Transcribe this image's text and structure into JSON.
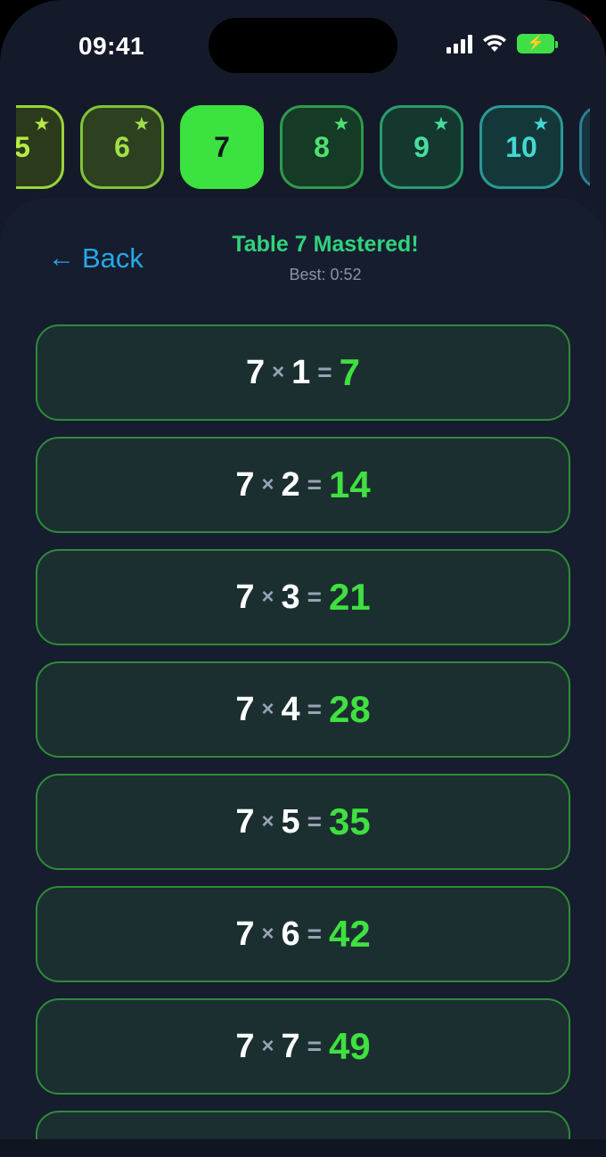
{
  "status_bar": {
    "time": "09:41"
  },
  "selector": {
    "chips": [
      {
        "label": "5",
        "starred": true
      },
      {
        "label": "6",
        "starred": true
      },
      {
        "label": "7",
        "starred": false,
        "selected": true
      },
      {
        "label": "8",
        "starred": true
      },
      {
        "label": "9",
        "starred": true
      },
      {
        "label": "10",
        "starred": true
      }
    ],
    "star_glyph": "★"
  },
  "header": {
    "back_label": "Back",
    "back_arrow": "←",
    "title": "Table 7 Mastered!",
    "subtitle": "Best: 0:52"
  },
  "equations": [
    {
      "a": "7",
      "op": "×",
      "b": "1",
      "eq": "=",
      "result": "7"
    },
    {
      "a": "7",
      "op": "×",
      "b": "2",
      "eq": "=",
      "result": "14"
    },
    {
      "a": "7",
      "op": "×",
      "b": "3",
      "eq": "=",
      "result": "21"
    },
    {
      "a": "7",
      "op": "×",
      "b": "4",
      "eq": "=",
      "result": "28"
    },
    {
      "a": "7",
      "op": "×",
      "b": "5",
      "eq": "=",
      "result": "35"
    },
    {
      "a": "7",
      "op": "×",
      "b": "6",
      "eq": "=",
      "result": "42"
    },
    {
      "a": "7",
      "op": "×",
      "b": "7",
      "eq": "=",
      "result": "49"
    }
  ],
  "colors": {
    "accent_green": "#3ce23f",
    "title_green": "#32d27c",
    "link_blue": "#27a8e8",
    "background": "#161d2e"
  },
  "icons": {
    "back": "arrow-left-icon",
    "star": "star-icon",
    "signal": "cellular-signal-icon",
    "wifi": "wifi-icon",
    "battery": "battery-charging-icon"
  }
}
